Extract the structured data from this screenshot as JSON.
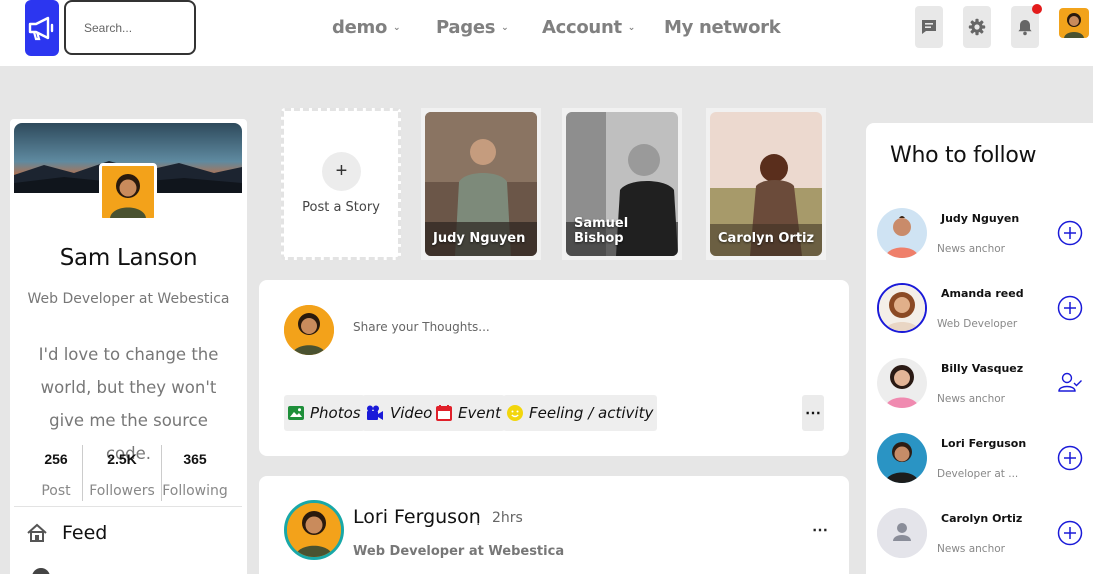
{
  "navbar": {
    "search_placeholder": "Search...",
    "menu": [
      {
        "label": "demo"
      },
      {
        "label": "Pages"
      },
      {
        "label": "Account"
      },
      {
        "label": "My network"
      }
    ],
    "icons": [
      "megaphone-icon",
      "chat-icon",
      "gear-icon",
      "bell-icon"
    ],
    "notification_dot_color": "#e31b1b",
    "brand_color": "#2c36f0"
  },
  "profile": {
    "name": "Sam Lanson",
    "role": "Web Developer at Webestica",
    "bio": "I'd love to change the world, but they won't give me the source code.",
    "stats": [
      {
        "value": "256",
        "label": "Post"
      },
      {
        "value": "2.5K",
        "label": "Followers"
      },
      {
        "value": "365",
        "label": "Following"
      }
    ],
    "nav": [
      {
        "label": "Feed",
        "icon": "home-icon"
      }
    ]
  },
  "stories": {
    "add_label": "Post a Story",
    "items": [
      {
        "name": "Judy Nguyen"
      },
      {
        "name": "Samuel Bishop"
      },
      {
        "name": "Carolyn Ortiz"
      }
    ]
  },
  "composer": {
    "placeholder": "Share your Thoughts...",
    "actions": [
      {
        "label": "Photos",
        "color": "#1e8f3a",
        "icon": "image-icon"
      },
      {
        "label": "Video",
        "color": "#1a1ad8",
        "icon": "video-camera-icon"
      },
      {
        "label": "Event",
        "color": "#e0202a",
        "icon": "calendar-icon"
      },
      {
        "label": "Feeling / activity",
        "color": "#f2d60c",
        "icon": "smiley-icon"
      }
    ]
  },
  "post": {
    "author": "Lori Ferguson",
    "separator": ".",
    "time": "2hrs",
    "role": "Web Developer at Webestica"
  },
  "who_to_follow": {
    "title": "Who to follow",
    "accent": "#1a1ad8",
    "items": [
      {
        "name": "Judy Nguyen",
        "role": "News anchor",
        "action": "add-circle-icon"
      },
      {
        "name": "Amanda reed",
        "role": "Web Developer",
        "action": "add-circle-icon"
      },
      {
        "name": "Billy Vasquez",
        "role": "News anchor",
        "action": "user-check-icon"
      },
      {
        "name": "Lori Ferguson",
        "role": "Developer at ...",
        "action": "add-circle-icon"
      },
      {
        "name": "Carolyn Ortiz",
        "role": "News anchor",
        "action": "add-circle-icon"
      }
    ]
  }
}
